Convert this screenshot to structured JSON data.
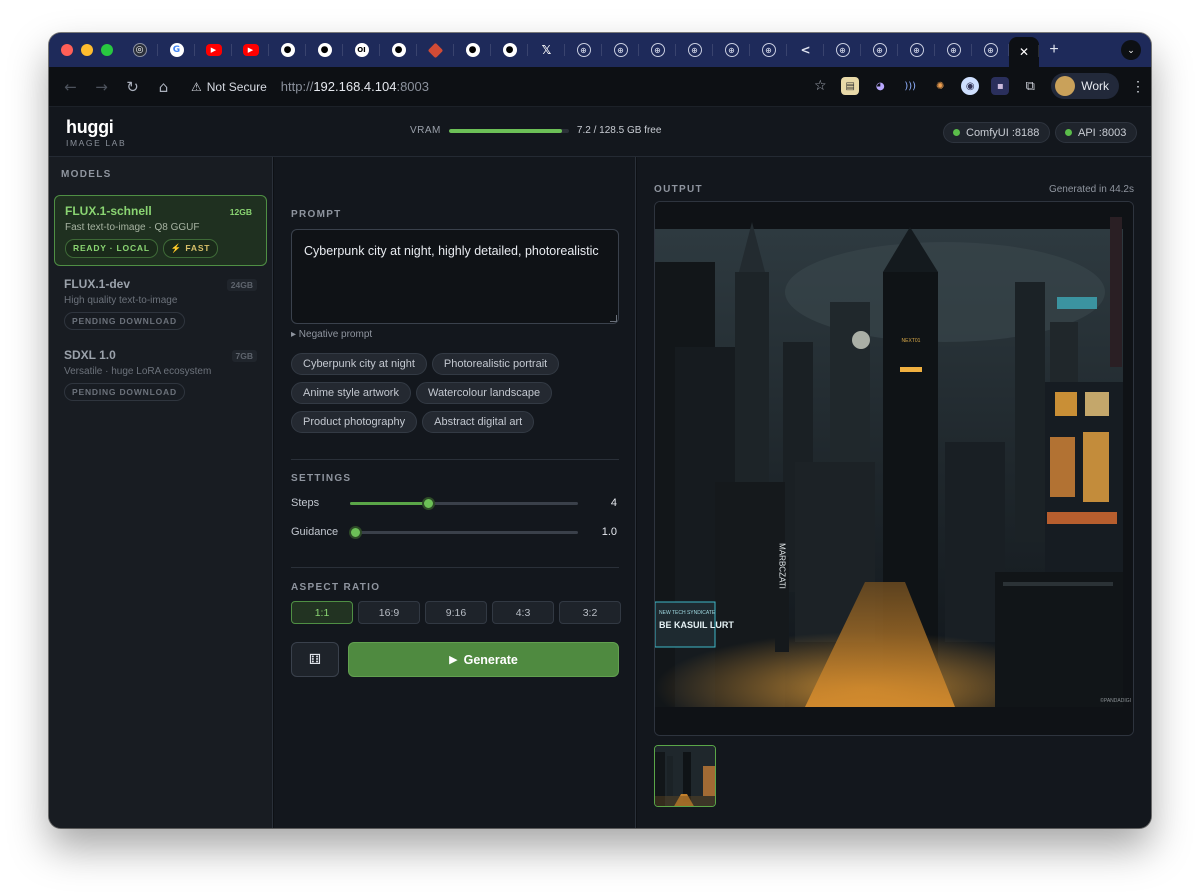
{
  "browser": {
    "tabs": [
      {
        "icon": "chatgpt-icon",
        "glyph": "◎"
      },
      {
        "icon": "google-icon",
        "glyph": "G"
      },
      {
        "icon": "youtube-icon",
        "glyph": "▶"
      },
      {
        "icon": "youtube-icon",
        "glyph": "▶"
      },
      {
        "icon": "github-icon",
        "glyph": "●"
      },
      {
        "icon": "github-icon",
        "glyph": "●"
      },
      {
        "icon": "ollama-icon",
        "glyph": "OI"
      },
      {
        "icon": "github-icon",
        "glyph": "●"
      },
      {
        "icon": "red-diamond-icon",
        "glyph": ""
      },
      {
        "icon": "github-icon",
        "glyph": "●"
      },
      {
        "icon": "github-icon",
        "glyph": "●"
      },
      {
        "icon": "x-icon",
        "glyph": "𝕏"
      },
      {
        "icon": "globe-icon",
        "glyph": "⊕"
      },
      {
        "icon": "globe-icon",
        "glyph": "⊕"
      },
      {
        "icon": "globe-icon",
        "glyph": "⊕"
      },
      {
        "icon": "globe-icon",
        "glyph": "⊕"
      },
      {
        "icon": "globe-icon",
        "glyph": "⊕"
      },
      {
        "icon": "globe-icon",
        "glyph": "⊕"
      },
      {
        "icon": "share-icon",
        "glyph": "<"
      },
      {
        "icon": "globe-icon",
        "glyph": "⊕"
      },
      {
        "icon": "globe-icon",
        "glyph": "⊕"
      },
      {
        "icon": "globe-icon",
        "glyph": "⊕"
      },
      {
        "icon": "globe-icon",
        "glyph": "⊕"
      },
      {
        "icon": "globe-icon",
        "glyph": "⊕"
      }
    ],
    "active_tab_close": "✕",
    "new_tab": "+",
    "tab_menu": "⌄",
    "security_label": "Not Secure",
    "url_scheme": "http://",
    "url_host": "192.168.4.104",
    "url_port": ":8003",
    "profile_name": "Work"
  },
  "header": {
    "brand": "huggi",
    "brand_sub": "IMAGE LAB",
    "vram_label": "VRAM",
    "vram_text": "7.2 / 128.5 GB free",
    "vram_fill_fraction": 0.94,
    "status_pills": [
      "ComfyUI :8188",
      "API :8003"
    ],
    "status_color": "#5bbd4a"
  },
  "sidebar": {
    "title": "MODELS",
    "models": [
      {
        "name": "FLUX.1-schnell",
        "size": "12GB",
        "desc": "Fast text-to-image · Q8 GGUF",
        "tags": [
          "READY · LOCAL",
          "⚡ FAST"
        ],
        "active": true
      },
      {
        "name": "FLUX.1-dev",
        "size": "24GB",
        "desc": "High quality text-to-image",
        "tags": [
          "PENDING DOWNLOAD"
        ],
        "active": false
      },
      {
        "name": "SDXL 1.0",
        "size": "7GB",
        "desc": "Versatile · huge LoRA ecosystem",
        "tags": [
          "PENDING DOWNLOAD"
        ],
        "active": false
      }
    ]
  },
  "prompt": {
    "title": "PROMPT",
    "value": "Cyberpunk city at night, highly detailed, photorealistic",
    "negative_link": "▸ Negative prompt",
    "presets": [
      "Cyberpunk city at night",
      "Photorealistic portrait",
      "Anime style artwork",
      "Watercolour landscape",
      "Product photography",
      "Abstract digital art"
    ]
  },
  "settings": {
    "title": "SETTINGS",
    "steps_label": "Steps",
    "steps_value": "4",
    "steps_fraction": 0.34,
    "guidance_label": "Guidance",
    "guidance_value": "1.0",
    "guidance_fraction": 0.02
  },
  "aspect": {
    "title": "ASPECT RATIO",
    "options": [
      "1:1",
      "16:9",
      "9:16",
      "4:3",
      "3:2"
    ],
    "selected": "1:1"
  },
  "actions": {
    "dice_icon": "⚅",
    "generate_label": "Generate",
    "play_icon": "▶"
  },
  "output": {
    "title": "OUTPUT",
    "generated": "Generated in 44.2s",
    "watermark": "©PANDADIGI",
    "image_signs": {
      "left_billboard_small": "NEW TECH SYNDICATE",
      "left_billboard": "BE KASUIL LURT",
      "vertical_sign": "MARBCZATI",
      "tower_sign": "NEXT01"
    }
  },
  "colors": {
    "accent": "#6cc057",
    "accent_dark": "#4f8a40",
    "bg": "#13171d",
    "tabstrip": "#1e2a5a"
  }
}
